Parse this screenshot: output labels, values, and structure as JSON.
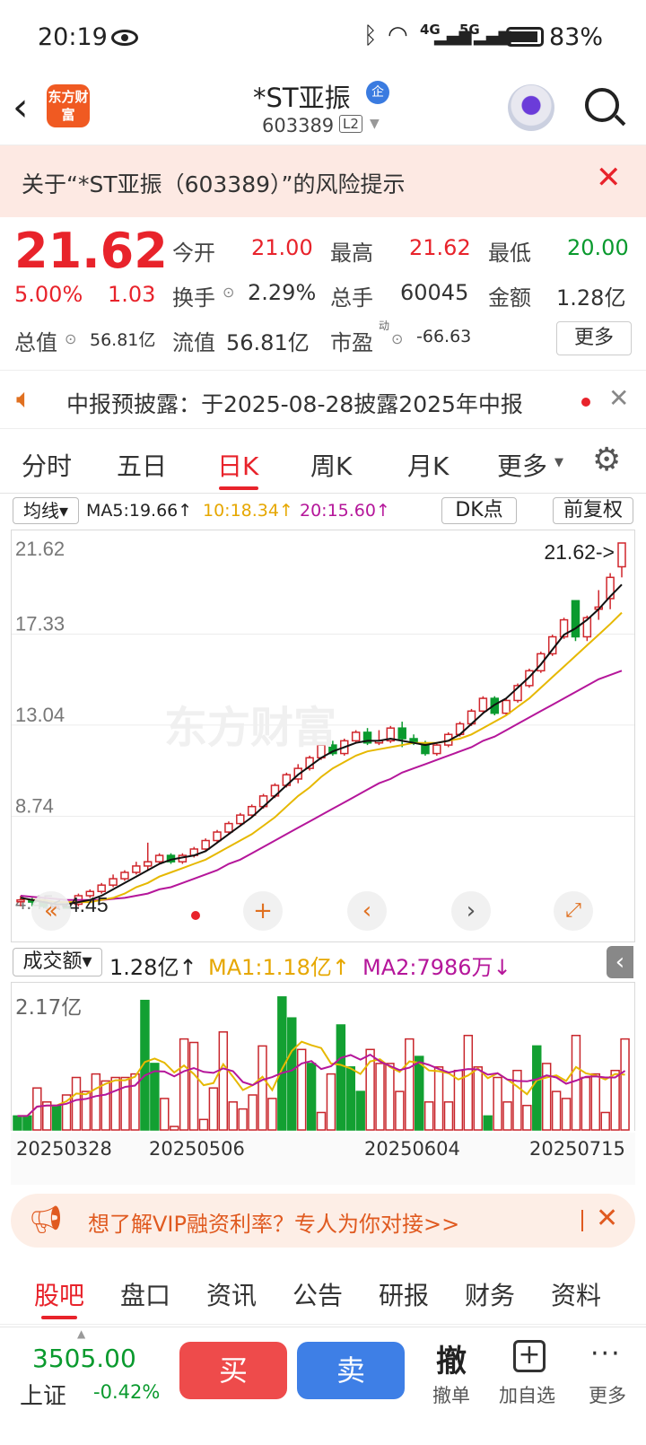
{
  "status": {
    "time": "20:19",
    "battery": "83%",
    "net1": "4G",
    "net2": "5G"
  },
  "header": {
    "title": "*ST亚振",
    "badge": "企",
    "code": "603389",
    "level": "L2",
    "logo": "东方财富"
  },
  "risk": {
    "text": "关于“*ST亚振（603389）”的风险提示"
  },
  "quote": {
    "price": "21.62",
    "pct": "5.00%",
    "chg": "1.03",
    "open_label": "今开",
    "open": "21.00",
    "high_label": "最高",
    "high": "21.62",
    "low_label": "最低",
    "low": "20.00",
    "turn_label": "换手",
    "turn": "2.29%",
    "vol_label": "总手",
    "vol": "60045",
    "amt_label": "金额",
    "amt": "1.28亿",
    "mcap_label": "总值",
    "mcap": "56.81亿",
    "float_label": "流值",
    "float": "56.81亿",
    "pe_label": "市盈",
    "pe_sup": "动",
    "pe": "-66.63",
    "more": "更多"
  },
  "notice": {
    "text": "中报预披露：于2025-08-28披露2025年中报"
  },
  "ktabs": [
    "分时",
    "五日",
    "日K",
    "周K",
    "月K",
    "更多"
  ],
  "ma": {
    "sel": "均线",
    "ma5": "MA5:19.66",
    "ma10": "10:18.34",
    "ma20": "20:15.60",
    "dk": "DK点",
    "fq": "前复权"
  },
  "chart_data": {
    "type": "candlestick",
    "ylabels": [
      "21.62",
      "17.33",
      "13.04",
      "8.74",
      "4.45"
    ],
    "ylim": [
      4.45,
      21.62
    ],
    "max_label": "21.62->",
    "min_label": "<-4.45",
    "candles": [
      [
        4.8,
        4.8,
        4.5,
        5.0
      ],
      [
        4.8,
        4.7,
        4.5,
        4.9
      ],
      [
        4.7,
        4.5,
        4.4,
        4.8
      ],
      [
        4.5,
        4.5,
        4.4,
        4.6
      ],
      [
        4.5,
        4.45,
        4.45,
        4.7
      ],
      [
        4.6,
        5.0,
        4.5,
        5.1
      ],
      [
        5.0,
        5.2,
        4.9,
        5.3
      ],
      [
        5.2,
        5.5,
        5.1,
        5.6
      ],
      [
        5.5,
        5.8,
        5.4,
        6.0
      ],
      [
        5.8,
        6.1,
        5.7,
        6.2
      ],
      [
        6.1,
        6.4,
        6.0,
        6.6
      ],
      [
        6.4,
        6.6,
        6.2,
        7.5
      ],
      [
        6.6,
        6.9,
        6.5,
        7.0
      ],
      [
        6.9,
        6.6,
        6.5,
        7.0
      ],
      [
        6.6,
        6.9,
        6.5,
        7.0
      ],
      [
        6.9,
        7.2,
        6.8,
        7.3
      ],
      [
        7.2,
        7.6,
        7.1,
        7.7
      ],
      [
        7.6,
        8.0,
        7.5,
        8.1
      ],
      [
        8.0,
        8.4,
        7.9,
        8.5
      ],
      [
        8.4,
        8.8,
        8.3,
        8.9
      ],
      [
        8.8,
        9.2,
        8.7,
        9.3
      ],
      [
        9.2,
        9.7,
        9.1,
        9.8
      ],
      [
        9.7,
        10.2,
        9.6,
        10.3
      ],
      [
        10.2,
        10.7,
        10.1,
        10.8
      ],
      [
        10.5,
        11.0,
        10.3,
        11.2
      ],
      [
        11.0,
        11.5,
        10.9,
        11.6
      ],
      [
        11.5,
        12.1,
        11.4,
        12.2
      ],
      [
        12.1,
        11.7,
        11.6,
        12.3
      ],
      [
        11.7,
        12.3,
        11.6,
        12.4
      ],
      [
        12.3,
        12.7,
        12.2,
        12.8
      ],
      [
        12.7,
        12.2,
        12.1,
        12.9
      ],
      [
        12.2,
        12.3,
        12.1,
        12.8
      ],
      [
        12.3,
        12.9,
        12.2,
        13.0
      ],
      [
        12.9,
        12.4,
        12.0,
        13.2
      ],
      [
        12.4,
        12.2,
        12.1,
        12.6
      ],
      [
        12.2,
        11.7,
        11.6,
        12.3
      ],
      [
        11.7,
        12.1,
        11.6,
        12.2
      ],
      [
        12.1,
        12.6,
        12.0,
        12.7
      ],
      [
        12.6,
        13.1,
        12.5,
        13.2
      ],
      [
        13.1,
        13.7,
        13.0,
        13.8
      ],
      [
        13.7,
        14.3,
        13.6,
        14.4
      ],
      [
        14.3,
        13.6,
        13.5,
        14.4
      ],
      [
        13.6,
        14.2,
        13.5,
        14.3
      ],
      [
        14.2,
        14.9,
        14.1,
        15.0
      ],
      [
        14.9,
        15.6,
        14.8,
        15.7
      ],
      [
        15.6,
        16.4,
        15.5,
        16.5
      ],
      [
        16.4,
        17.2,
        16.3,
        17.3
      ],
      [
        17.2,
        18.0,
        17.1,
        18.1
      ],
      [
        18.9,
        17.2,
        17.0,
        18.9
      ],
      [
        17.2,
        18.1,
        17.0,
        18.2
      ],
      [
        18.5,
        18.6,
        18.0,
        19.4
      ],
      [
        19.0,
        20.0,
        18.5,
        20.2
      ],
      [
        20.5,
        21.62,
        20.0,
        21.62
      ]
    ],
    "ma5": [
      4.9,
      4.8,
      4.7,
      4.6,
      4.6,
      4.7,
      4.8,
      5.0,
      5.3,
      5.6,
      5.9,
      6.2,
      6.5,
      6.7,
      6.8,
      6.9,
      7.1,
      7.5,
      7.9,
      8.3,
      8.7,
      9.2,
      9.7,
      10.2,
      10.7,
      11.1,
      11.5,
      11.8,
      12.0,
      12.2,
      12.3,
      12.3,
      12.4,
      12.3,
      12.2,
      12.1,
      12.2,
      12.3,
      12.6,
      13.1,
      13.6,
      14.0,
      14.3,
      14.8,
      15.3,
      15.9,
      16.6,
      17.3,
      17.6,
      18.0,
      18.5,
      19.1,
      19.66
    ],
    "ma10": [
      4.9,
      4.8,
      4.8,
      4.7,
      4.7,
      4.7,
      4.7,
      4.8,
      4.9,
      5.1,
      5.4,
      5.6,
      5.9,
      6.1,
      6.3,
      6.5,
      6.7,
      7.0,
      7.3,
      7.6,
      7.9,
      8.3,
      8.7,
      9.2,
      9.7,
      10.1,
      10.6,
      11.0,
      11.3,
      11.6,
      11.8,
      11.9,
      12.0,
      12.1,
      12.2,
      12.2,
      12.2,
      12.3,
      12.4,
      12.6,
      12.9,
      13.2,
      13.5,
      13.9,
      14.3,
      14.8,
      15.3,
      15.8,
      16.3,
      16.8,
      17.3,
      17.8,
      18.34
    ],
    "ma20": [
      5.0,
      4.95,
      4.9,
      4.85,
      4.8,
      4.8,
      4.8,
      4.8,
      4.85,
      4.9,
      5.0,
      5.1,
      5.3,
      5.4,
      5.6,
      5.8,
      6.0,
      6.2,
      6.5,
      6.7,
      7.0,
      7.3,
      7.6,
      7.9,
      8.2,
      8.5,
      8.8,
      9.1,
      9.4,
      9.7,
      10.0,
      10.3,
      10.5,
      10.8,
      11.0,
      11.2,
      11.4,
      11.6,
      11.8,
      12.0,
      12.3,
      12.5,
      12.8,
      13.1,
      13.4,
      13.7,
      14.0,
      14.3,
      14.6,
      14.9,
      15.2,
      15.4,
      15.6
    ]
  },
  "vol": {
    "sel": "成交额",
    "val": "1.28亿",
    "ma1": "MA1:1.18亿",
    "ma2": "MA2:7986万",
    "max": "2.17亿",
    "bars": [
      0.2,
      0.2,
      0.6,
      0.4,
      0.35,
      0.5,
      0.75,
      0.55,
      0.8,
      0.7,
      0.75,
      0.75,
      0.8,
      1.85,
      0.95,
      0.45,
      0.05,
      1.3,
      1.25,
      0.15,
      0.6,
      1.4,
      0.4,
      0.3,
      0.5,
      1.2,
      0.45,
      1.9,
      1.6,
      1.15,
      0.95,
      0.25,
      0.8,
      1.5,
      0.9,
      0.55,
      1.15,
      0.95,
      0.95,
      0.55,
      1.3,
      1.05,
      0.4,
      0.9,
      0.4,
      0.85,
      1.35,
      0.9,
      0.2,
      0.75,
      0.4,
      0.85,
      0.35,
      1.2,
      0.95,
      0.55,
      0.45,
      1.35,
      0.75,
      0.8,
      0.25,
      0.85,
      1.3
    ],
    "green": [
      0,
      1,
      4,
      13,
      14,
      27,
      28,
      30,
      33,
      34,
      35,
      41,
      48,
      53
    ],
    "dates": [
      "20250328",
      "20250506",
      "20250604",
      "20250715"
    ]
  },
  "vip": {
    "text": "想了解VIP融资利率？专人为你对接>>"
  },
  "btabs": [
    "股吧",
    "盘口",
    "资讯",
    "公告",
    "研报",
    "财务",
    "资料"
  ],
  "footer": {
    "index_val": "3505.00",
    "index_name": "上证",
    "index_chg": "-0.42%",
    "buy": "买",
    "sell": "卖",
    "cancel_icon": "撤",
    "cancel": "撤单",
    "add": "加自选",
    "more": "更多"
  }
}
